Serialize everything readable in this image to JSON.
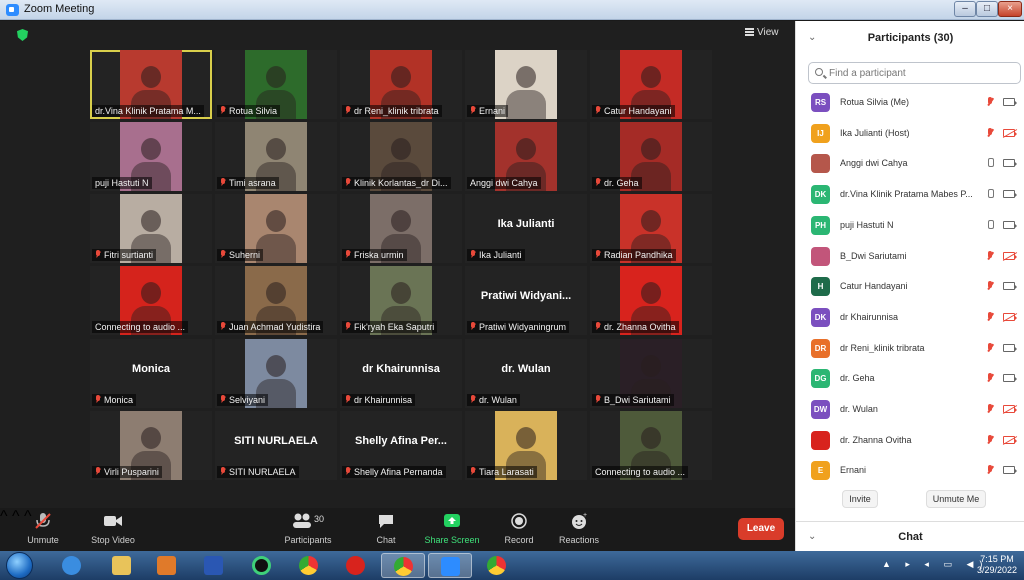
{
  "window": {
    "title": "Zoom Meeting",
    "min": "–",
    "max": "□",
    "close": "×"
  },
  "meeting": {
    "view_label": "View",
    "tiles": [
      {
        "name": "dr.Vina Klinik Pratama M...",
        "muted": false,
        "active": true,
        "bg": "#b83a2f"
      },
      {
        "name": "Rotua Silvia",
        "muted": true,
        "bg": "#2d6b2b"
      },
      {
        "name": "dr Reni_klinik tribrata",
        "muted": true,
        "bg": "#b23226"
      },
      {
        "name": "Ernani",
        "muted": true,
        "bg": "#dcd3c6"
      },
      {
        "name": "Catur Handayani",
        "muted": true,
        "bg": "#c42b25"
      },
      {
        "name": "puji Hastuti N",
        "muted": false,
        "bg": "#a86f8e"
      },
      {
        "name": "Timi asrana",
        "muted": true,
        "bg": "#8f8573"
      },
      {
        "name": "Klinik Korlantas_dr Di...",
        "muted": true,
        "bg": "#5a4a3c"
      },
      {
        "name": "Anggi dwi Cahya",
        "muted": false,
        "bg": "#a3322c"
      },
      {
        "name": "dr. Geha",
        "muted": true,
        "bg": "#a52b26"
      },
      {
        "name": "Fitri surtianti",
        "muted": true,
        "bg": "#b8ada2"
      },
      {
        "name": "Suherni",
        "muted": true,
        "bg": "#a9866f"
      },
      {
        "name": "Friska urmin",
        "muted": true,
        "bg": "#7c6e68"
      },
      {
        "name": "Ika Julianti",
        "muted": true,
        "big": "Ika Julianti"
      },
      {
        "name": "Radian Pandhika",
        "muted": true,
        "bg": "#c93229"
      },
      {
        "name": "Connecting to audio ...",
        "muted": false,
        "bg": "#d5231c"
      },
      {
        "name": "Juan Achmad Yudistira",
        "muted": true,
        "bg": "#8a6a4a"
      },
      {
        "name": "Fik'ryah Eka Saputri",
        "muted": true,
        "bg": "#6a7455"
      },
      {
        "name": "Pratiwi Widyaningrum",
        "muted": true,
        "big": "Pratiwi  Widyani..."
      },
      {
        "name": "dr. Zhanna Ovitha",
        "muted": true,
        "bg": "#d8231d"
      },
      {
        "name": "Monica",
        "muted": true,
        "big": "Monica"
      },
      {
        "name": "Selviyani",
        "muted": true,
        "bg": "#7d8aa0"
      },
      {
        "name": "dr Khairunnisa",
        "muted": true,
        "big": "dr Khairunnisa"
      },
      {
        "name": "dr. Wulan",
        "muted": true,
        "big": "dr. Wulan"
      },
      {
        "name": "B_Dwi Sariutami",
        "muted": true,
        "bg": "#2a1f26"
      },
      {
        "name": "Virli Pusparini",
        "muted": true,
        "bg": "#8d7d71"
      },
      {
        "name": "SITI NURLAELA",
        "muted": true,
        "big": "SITI NURLAELA"
      },
      {
        "name": "Shelly Afina Pernanda",
        "muted": true,
        "big": "Shelly Afina Per..."
      },
      {
        "name": "Tiara Larasati",
        "muted": true,
        "bg": "#d9b25a"
      },
      {
        "name": "Connecting to audio ...",
        "muted": false,
        "bg": "#4e5a3a"
      }
    ]
  },
  "toolbar": {
    "unmute": "Unmute",
    "stop_video": "Stop Video",
    "participants": "Participants",
    "participants_count": "30",
    "chat": "Chat",
    "share_screen": "Share Screen",
    "record": "Record",
    "reactions": "Reactions",
    "leave": "Leave"
  },
  "panel": {
    "title": "Participants (30)",
    "search_placeholder": "Find a participant",
    "participants": [
      {
        "initials": "RS",
        "name": "Rotua Silvia (Me)",
        "color": "#7b4fbf",
        "muted": true,
        "cam_off": false
      },
      {
        "initials": "IJ",
        "name": "Ika Julianti (Host)",
        "color": "#f0a11d",
        "muted": true,
        "cam_off": true
      },
      {
        "initials": "",
        "name": "Anggi dwi Cahya",
        "color": "#b5574b",
        "muted": false,
        "cam_off": false
      },
      {
        "initials": "DK",
        "name": "dr.Vina Klinik Pratama Mabes P...",
        "color": "#2bb673",
        "muted": false,
        "cam_off": false
      },
      {
        "initials": "PH",
        "name": "puji Hastuti N",
        "color": "#2bb673",
        "muted": false,
        "cam_off": false
      },
      {
        "initials": "",
        "name": "B_Dwi Sariutami",
        "color": "#c2557a",
        "muted": true,
        "cam_off": true
      },
      {
        "initials": "H",
        "name": "Catur Handayani",
        "color": "#1e6b4a",
        "muted": true,
        "cam_off": false
      },
      {
        "initials": "DK",
        "name": "dr Khairunnisa",
        "color": "#7b4fbf",
        "muted": true,
        "cam_off": true
      },
      {
        "initials": "DR",
        "name": "dr Reni_klinik tribrata",
        "color": "#e8702a",
        "muted": true,
        "cam_off": false
      },
      {
        "initials": "DG",
        "name": "dr. Geha",
        "color": "#2bb673",
        "muted": true,
        "cam_off": false
      },
      {
        "initials": "DW",
        "name": "dr. Wulan",
        "color": "#7b4fbf",
        "muted": true,
        "cam_off": true
      },
      {
        "initials": "",
        "name": "dr. Zhanna Ovitha",
        "color": "#d8231d",
        "muted": true,
        "cam_off": true
      },
      {
        "initials": "E",
        "name": "Ernani",
        "color": "#f0a11d",
        "muted": true,
        "cam_off": false
      }
    ],
    "invite": "Invite",
    "unmute_me": "Unmute Me",
    "chat_title": "Chat"
  },
  "taskbar": {
    "time": "7:15 PM",
    "date": "3/29/2022",
    "tray": "▲ ▸ ◂ ▭ ◀)"
  }
}
